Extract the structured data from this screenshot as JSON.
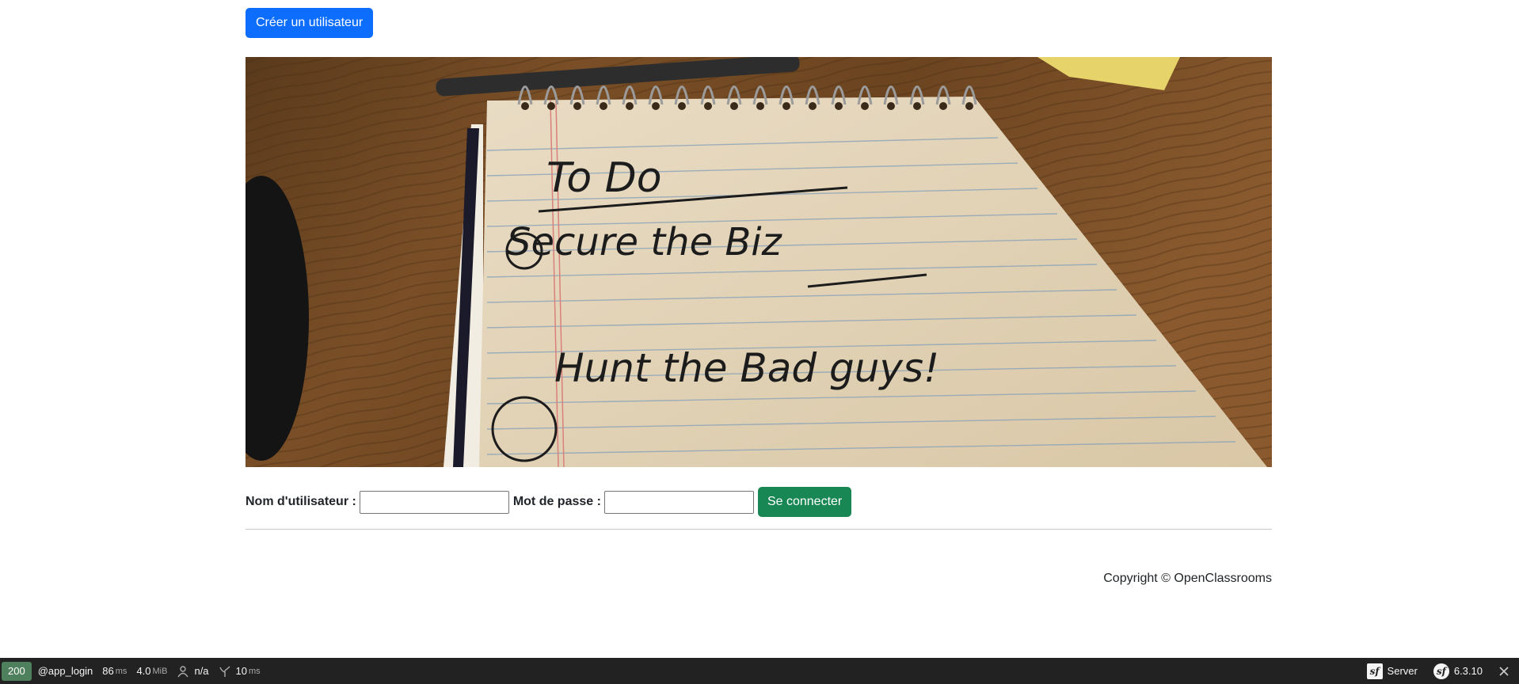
{
  "header": {
    "create_user_label": "Créer un utilisateur"
  },
  "hero": {
    "icon": "todo-notepad-image",
    "image_text": [
      "To Do",
      "Secure the Biz",
      "Hunt the Bad guys!"
    ]
  },
  "login_form": {
    "username_label": "Nom d'utilisateur :",
    "username_value": "",
    "password_label": "Mot de passe :",
    "password_value": "",
    "submit_label": "Se connecter"
  },
  "footer": {
    "copyright": "Copyright © OpenClassrooms"
  },
  "debug_toolbar": {
    "status_code": "200",
    "route": "@app_login",
    "time_value": "86",
    "time_unit": "ms",
    "memory_value": "4.0",
    "memory_unit": "MiB",
    "user": "n/a",
    "twig_value": "10",
    "twig_unit": "ms",
    "server_label": "Server",
    "version": "6.3.10",
    "status_color": "#4f805d"
  },
  "colors": {
    "primary": "#0d6efd",
    "success": "#198754",
    "toolbar_bg": "#222222"
  }
}
